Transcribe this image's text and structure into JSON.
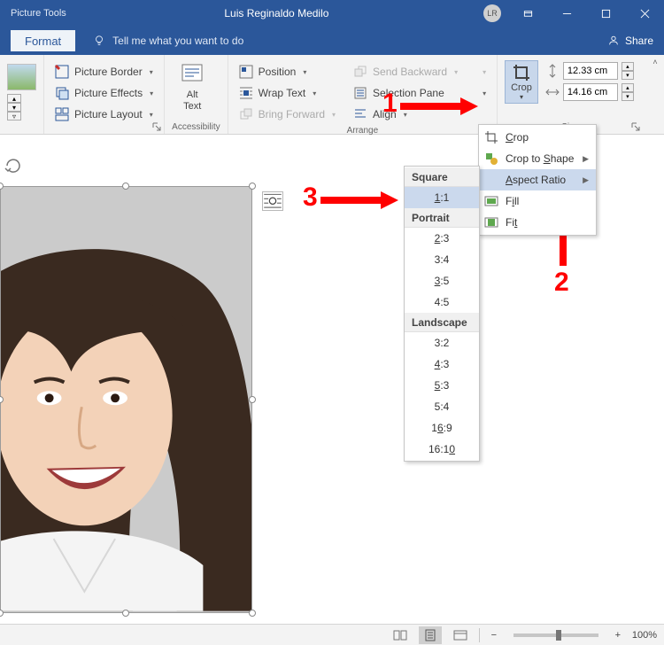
{
  "titlebar": {
    "tools_label": "Picture Tools",
    "doc_title": "Luis Reginaldo Medilo",
    "avatar_initials": "LR"
  },
  "tabrow": {
    "format_tab": "Format",
    "tellme": "Tell me what you want to do",
    "share": "Share"
  },
  "ribbon": {
    "picture_border": "Picture Border",
    "picture_effects": "Picture Effects",
    "picture_layout": "Picture Layout",
    "alt_text": "Alt\nText",
    "accessibility_group": "Accessibility",
    "position": "Position",
    "wrap_text": "Wrap Text",
    "bring_forward": "Bring Forward",
    "send_backward": "Send Backward",
    "selection_pane": "Selection Pane",
    "align": "Align",
    "arrange_group": "Arrange",
    "crop": "Crop",
    "height_value": "12.33 cm",
    "width_value": "14.16 cm",
    "size_group": "Size"
  },
  "crop_menu": {
    "crop": "Crop",
    "crop_to_shape": "Crop to Shape",
    "aspect_ratio": "Aspect Ratio",
    "fill": "Fill",
    "fit": "Fit"
  },
  "ar_menu": {
    "square_header": "Square",
    "r_1_1": "1:1",
    "portrait_header": "Portrait",
    "r_2_3": "2:3",
    "r_3_4": "3:4",
    "r_3_5": "3:5",
    "r_4_5": "4:5",
    "landscape_header": "Landscape",
    "r_3_2": "3:2",
    "r_4_3": "4:3",
    "r_5_3": "5:3",
    "r_5_4": "5:4",
    "r_16_9": "16:9",
    "r_16_10": "16:10"
  },
  "annotations": {
    "n1": "1",
    "n2": "2",
    "n3": "3"
  },
  "statusbar": {
    "zoom_pct": "100%"
  }
}
